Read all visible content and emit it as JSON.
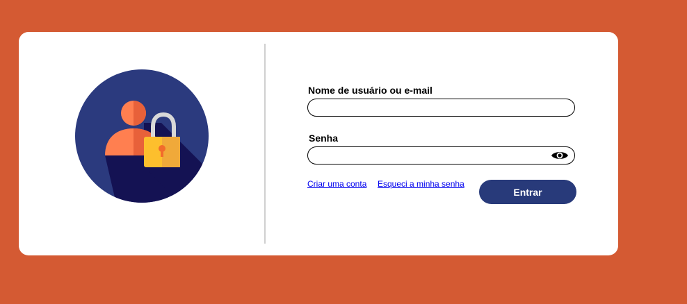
{
  "colors": {
    "background": "#D45A33",
    "card": "#FFFFFF",
    "accent": "#283A7A",
    "link": "#0000EE"
  },
  "illustration": {
    "icon": "user-lock-icon"
  },
  "form": {
    "username_label": "Nome de usuário ou e-mail",
    "username_value": "",
    "password_label": "Senha",
    "password_value": "",
    "show_password_icon": "eye-icon",
    "create_account_link": "Criar uma conta",
    "forgot_password_link": "Esqueci a minha senha",
    "submit_label": "Entrar"
  }
}
